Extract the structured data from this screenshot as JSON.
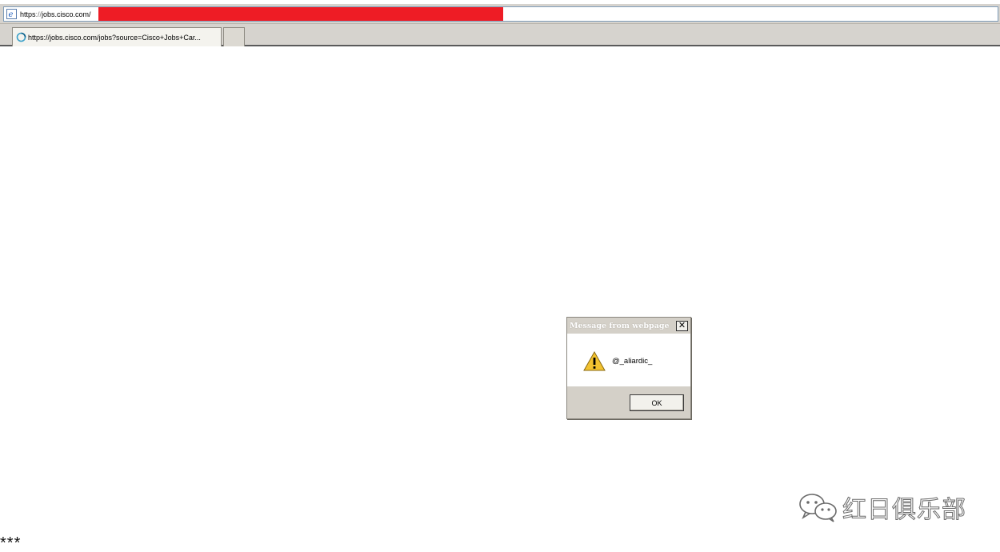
{
  "address_bar": {
    "url_scheme": "https",
    "url_separator": "://",
    "url_host": "jobs.cisco.com/",
    "redaction_color": "#ee1c25",
    "icon": "ie-page-icon"
  },
  "tabs": [
    {
      "title": "https://jobs.cisco.com/jobs?source=Cisco+Jobs+Car...",
      "icon": "loading-spinner-icon"
    }
  ],
  "dialog": {
    "title": "Message from webpage",
    "close_label": "✕",
    "message": "@_aliardic_",
    "icon": "warning-icon",
    "ok_label": "OK"
  },
  "watermark": {
    "icon": "wechat-icon",
    "text": "红日俱乐部"
  },
  "footer": {
    "text": "***"
  }
}
